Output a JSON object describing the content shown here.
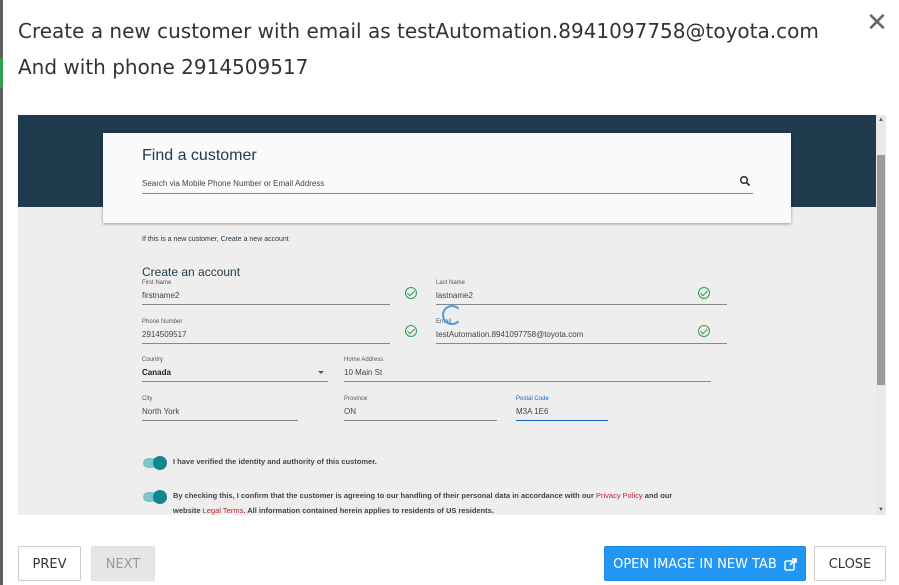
{
  "dialog": {
    "title": "Create a new customer with email as testAutomation.8941097758@toyota.com And with phone 2914509517",
    "close_glyph": "✕"
  },
  "screenshot": {
    "find_customer": {
      "heading": "Find a customer",
      "search_placeholder": "Search via Mobile Phone Number or Email Address"
    },
    "new_customer_text": "If this is a new customer,",
    "new_customer_link": "Create a new account",
    "create_account": {
      "heading": "Create an account",
      "first_name_label": "First Name",
      "first_name": "firstname2",
      "last_name_label": "Last Name",
      "last_name": "lastname2",
      "phone_label": "Phone Number",
      "phone": "2914509517",
      "email_label": "Email",
      "email": "testAutomation.8941097758@toyota.com",
      "country_label": "Country",
      "country": "Canada",
      "home_address_label": "Home Address",
      "home_address": "10 Main St",
      "city_label": "City",
      "city": "North York",
      "province_label": "Province",
      "province": "ON",
      "postal_label": "Postal Code",
      "postal": "M3A 1E6"
    },
    "consent_1": "I have verified the identity and authority of this customer.",
    "consent_2_line1_a": "By checking this, I confirm that the customer is agreeing to our handling of their personal data in accordance with our",
    "consent_2_privacy": "Privacy Policy",
    "consent_2_line1_b": "and our",
    "consent_2_line2_a": "website",
    "consent_2_legal": "Legal Terms",
    "consent_2_line2_b": ". All information contained herein applies to residents of US residents."
  },
  "footer": {
    "prev_label": "PREV",
    "next_label": "NEXT",
    "open_label": "OPEN IMAGE IN NEW TAB",
    "close_label": "CLOSE"
  },
  "colors": {
    "accent": "#2196f3",
    "nav": "#1e3a4c",
    "toggle": "#11868c",
    "valid": "#2e9e4f"
  }
}
